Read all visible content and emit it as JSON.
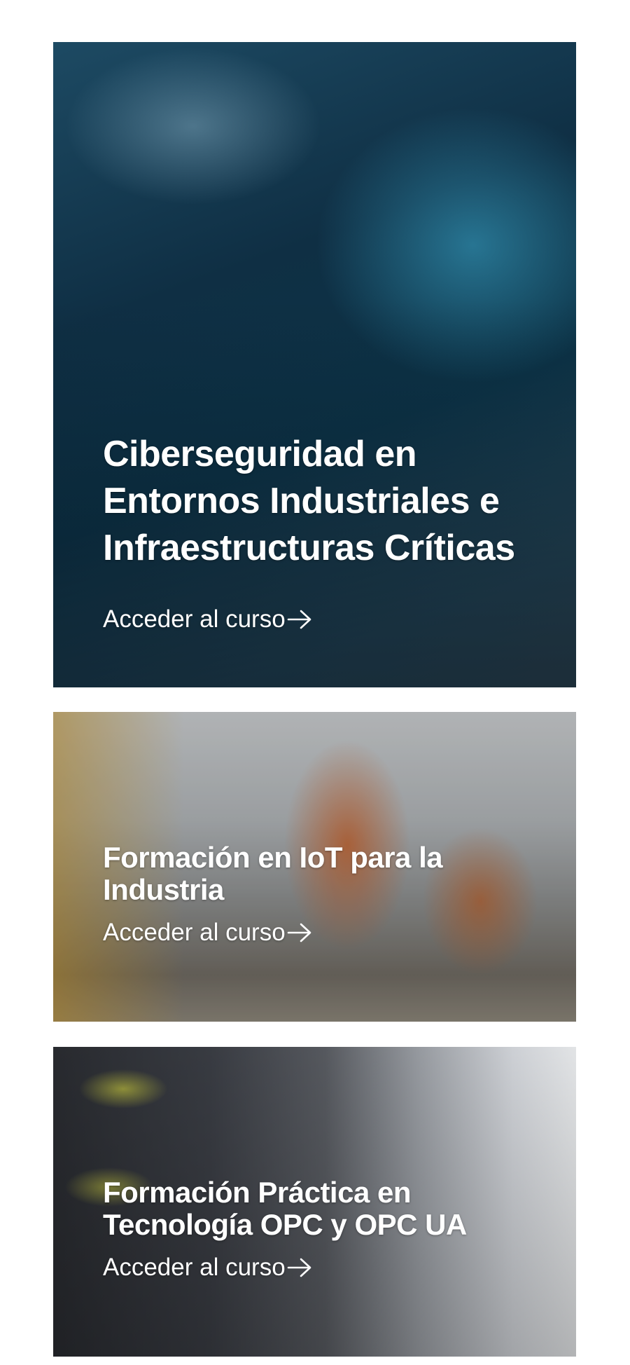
{
  "courses": [
    {
      "title": "Ciberseguridad en Entornos Industriales e Infraestructuras Críticas",
      "cta_label": "Acceder al curso"
    },
    {
      "title": "Formación en IoT para la Industria",
      "cta_label": "Acceder al curso"
    },
    {
      "title": "Formación Práctica en Tecnología OPC y OPC UA",
      "cta_label": "Acceder al curso"
    }
  ],
  "icons": {
    "cta": "arrow-right-icon"
  }
}
